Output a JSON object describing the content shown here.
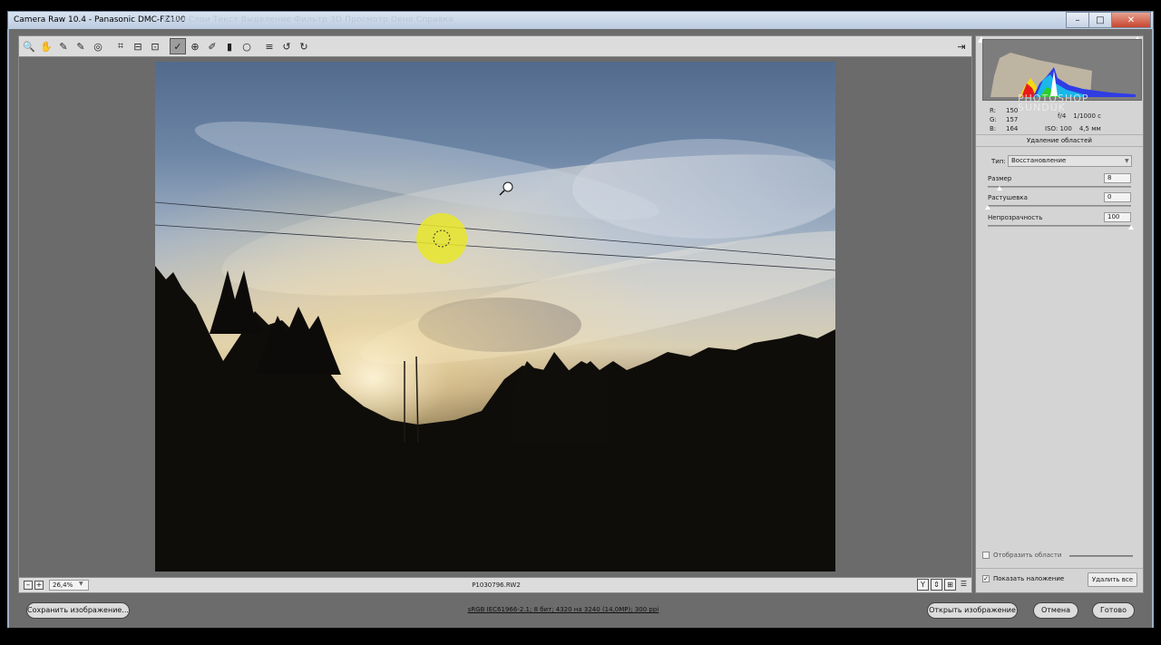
{
  "window": {
    "title": "Camera Raw 10.4  -  Panasonic DMC-FZ100",
    "ghost_menu": "Файл  Слои  Текст  Выделение  Фильтр  3D  Просмотр  Окно  Справка",
    "minimize": "–",
    "maximize": "□",
    "close": "✕"
  },
  "toolbar": {
    "tools": [
      {
        "name": "zoom-tool",
        "icon": "🔍"
      },
      {
        "name": "hand-tool",
        "icon": "✋"
      },
      {
        "name": "white-balance-tool",
        "icon": "✎"
      },
      {
        "name": "color-sampler-tool",
        "icon": "✎"
      },
      {
        "name": "targeted-adjustment-tool",
        "icon": "◎"
      },
      {
        "name": "crop-tool",
        "icon": "⌗"
      },
      {
        "name": "straighten-tool",
        "icon": "⊟"
      },
      {
        "name": "transform-tool",
        "icon": "⊡"
      },
      {
        "name": "spot-removal-tool",
        "icon": "✓",
        "active": true
      },
      {
        "name": "red-eye-tool",
        "icon": "⊕"
      },
      {
        "name": "adjustment-brush-tool",
        "icon": "✐"
      },
      {
        "name": "graduated-filter-tool",
        "icon": "▮"
      },
      {
        "name": "radial-filter-tool",
        "icon": "○"
      },
      {
        "name": "preferences-tool",
        "icon": "≡"
      },
      {
        "name": "rotate-left-tool",
        "icon": "↺"
      },
      {
        "name": "rotate-right-tool",
        "icon": "↻"
      }
    ],
    "exit_icon": "⇥"
  },
  "status": {
    "zoom_minus": "–",
    "zoom_plus": "+",
    "zoom": "26,4%",
    "filename": "P1030796.RW2",
    "view_buttons": [
      "Y",
      "⇕",
      "⊞",
      "☰"
    ]
  },
  "info": {
    "watermark_top": "PHOTOSHOP",
    "watermark_bottom": "SUNDUK",
    "r_label": "R:",
    "r_value": "150",
    "g_label": "G:",
    "g_value": "157",
    "b_label": "B:",
    "b_value": "164",
    "aperture": "f/4",
    "shutter": "1/1000 с",
    "iso": "ISO: 100",
    "focal": "4,5 мм"
  },
  "spot_removal": {
    "title": "Удаление областей",
    "type_label": "Тип:",
    "type_value": "Восстановление",
    "sliders": [
      {
        "label": "Размер",
        "value": "8",
        "fraction": 0.08
      },
      {
        "label": "Растушевка",
        "value": "0",
        "fraction": 0.0
      },
      {
        "label": "Непрозрачность",
        "value": "100",
        "fraction": 1.0
      }
    ],
    "visualize_label": "Отобразить области",
    "visualize_checked": false,
    "show_overlay_label": "Показать наложение",
    "show_overlay_checked": true,
    "clear_all": "Удалить все"
  },
  "footer": {
    "save": "Сохранить изображение...",
    "workflow": "sRGB IEC61966-2.1; 8 бит; 4320 на 3240 (14,0MP); 300 ppi",
    "open": "Открыть изображение",
    "cancel": "Отмена",
    "done": "Готово"
  },
  "colors": {
    "spot_marker": "#e8e62a",
    "panel_bg": "#d4d4d4",
    "canvas_bg": "#6b6b6b"
  }
}
